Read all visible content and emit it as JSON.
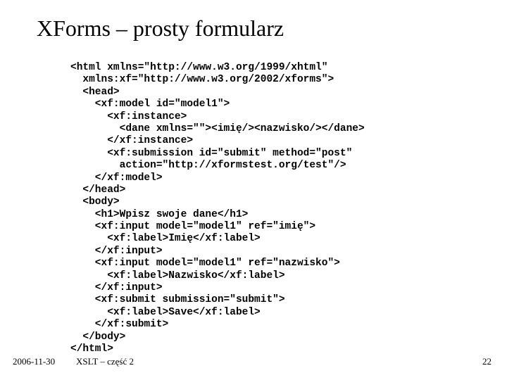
{
  "title": "XForms – prosty formularz",
  "code_lines": [
    "<html xmlns=\"http://www.w3.org/1999/xhtml\"",
    "  xmlns:xf=\"http://www.w3.org/2002/xforms\">",
    "  <head>",
    "    <xf:model id=\"model1\">",
    "      <xf:instance>",
    "        <dane xmlns=\"\"><imię/><nazwisko/></dane>",
    "      </xf:instance>",
    "      <xf:submission id=\"submit\" method=\"post\"",
    "        action=\"http://xformstest.org/test\"/>",
    "    </xf:model>",
    "  </head>",
    "  <body>",
    "    <h1>Wpisz swoje dane</h1>",
    "    <xf:input model=\"model1\" ref=\"imię\">",
    "      <xf:label>Imię</xf:label>",
    "    </xf:input>",
    "    <xf:input model=\"model1\" ref=\"nazwisko\">",
    "      <xf:label>Nazwisko</xf:label>",
    "    </xf:input>",
    "    <xf:submit submission=\"submit\">",
    "      <xf:label>Save</xf:label>",
    "    </xf:submit>",
    "  </body>",
    "</html>"
  ],
  "footer": {
    "date": "2006-11-30",
    "center": "XSLT – część 2",
    "page": "22"
  }
}
